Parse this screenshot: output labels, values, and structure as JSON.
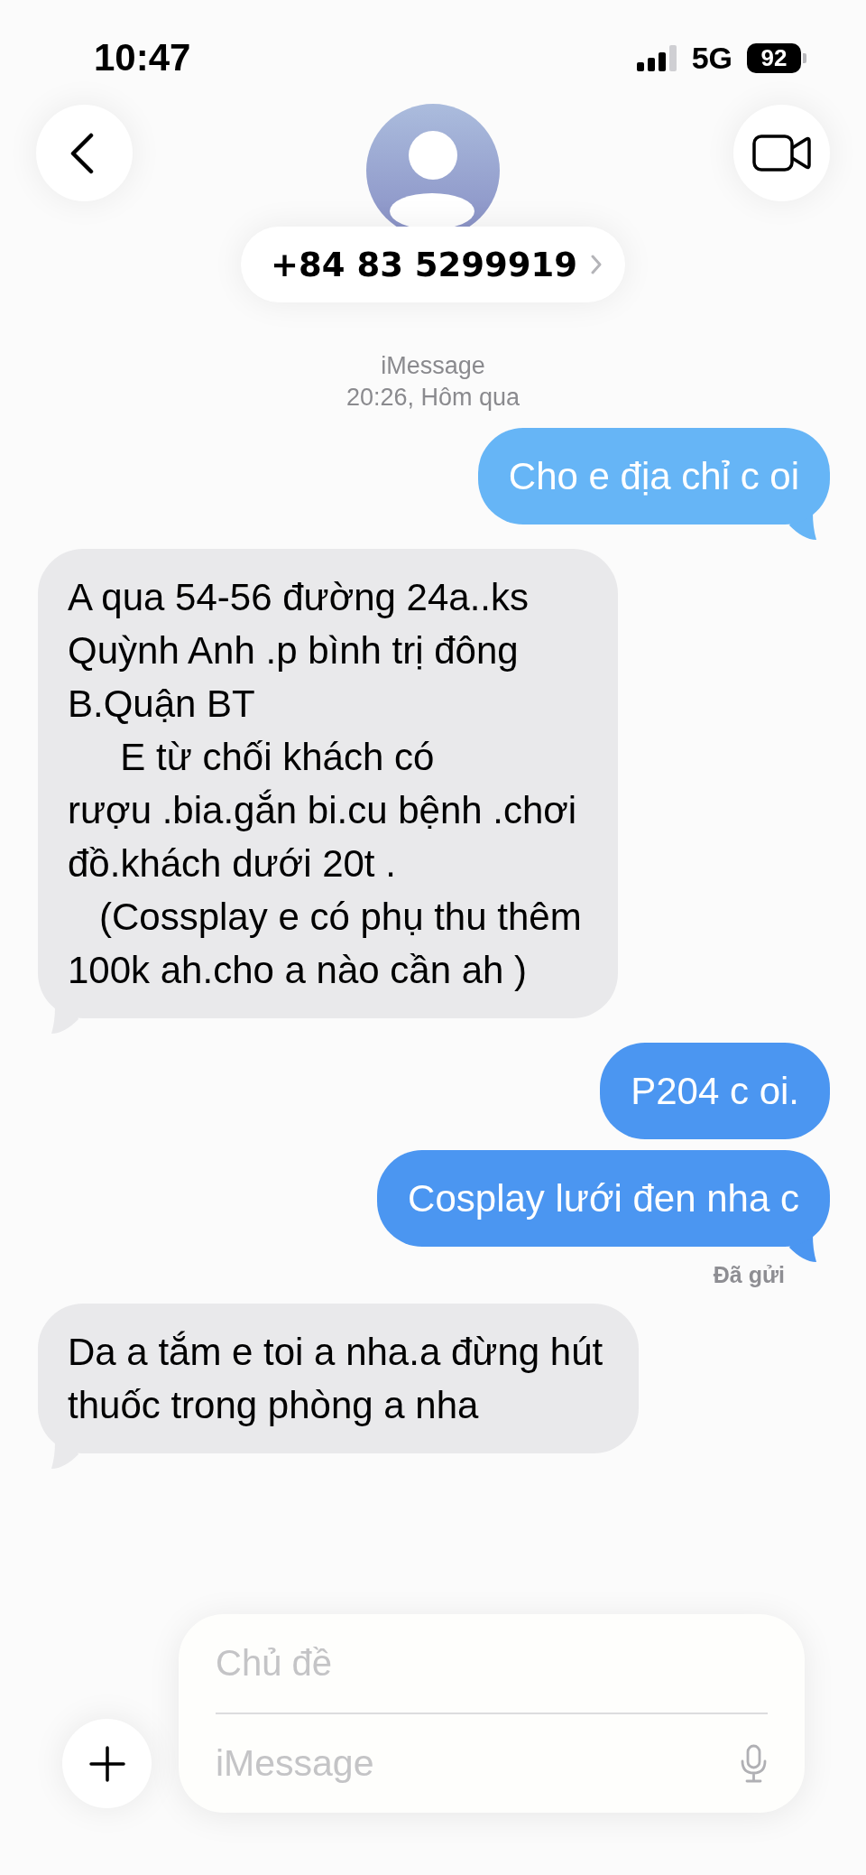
{
  "status_bar": {
    "time": "10:47",
    "network": "5G",
    "battery": "92"
  },
  "header": {
    "contact": "+84 83 5299919"
  },
  "thread_info": {
    "service": "iMessage",
    "timestamp": "20:26, Hôm qua"
  },
  "messages": [
    {
      "kind": "sent",
      "color": "#66b5f6",
      "lines": [
        "Cho e địa chỉ c oi"
      ]
    },
    {
      "kind": "received",
      "color": "#e9e9eb",
      "lines": [
        "A qua 54-56 đường 24a..ks",
        "Quỳnh Anh .p bình trị đông",
        "B.Quận BT",
        "     E từ chối khách có",
        "rượu .bia.gắn bi.cu bệnh .chơi",
        "đồ.khách dưới 20t .",
        "   (Cossplay e có phụ thu thêm",
        "100k ah.cho a nào cần ah )"
      ]
    },
    {
      "kind": "sent",
      "color": "#4b96f1",
      "lines": [
        "P204 c oi."
      ]
    },
    {
      "kind": "sent",
      "color": "#4b96f1",
      "lines": [
        "Cosplay lưới đen nha c"
      ],
      "status": "Đã gửi"
    },
    {
      "kind": "received",
      "color": "#e9e9eb",
      "lines": [
        "Da a tắm e toi a nha.a đừng hút",
        "thuốc trong phòng a nha"
      ]
    }
  ],
  "compose": {
    "subject_placeholder": "Chủ đề",
    "message_placeholder": "iMessage"
  }
}
